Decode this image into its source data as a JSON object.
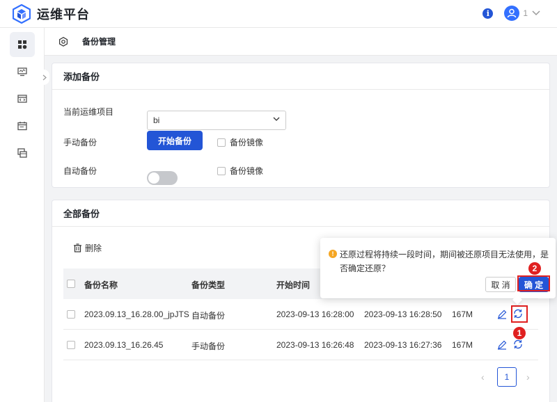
{
  "header": {
    "app_title": "运维平台",
    "info_label": "i",
    "user_name": "1"
  },
  "sidebar": {
    "items": [
      "dashboard-icon",
      "monitor-icon",
      "code-window-icon",
      "calendar-icon",
      "windows-icon"
    ],
    "active_index": 0
  },
  "breadcrumb": {
    "title": "备份管理"
  },
  "add_backup": {
    "title": "添加备份",
    "project_label": "当前运维项目",
    "project_value": "bi",
    "manual_label": "手动备份",
    "start_button": "开始备份",
    "manual_mirror_label": "备份镜像",
    "auto_label": "自动备份",
    "auto_enabled": false,
    "auto_mirror_label": "备份镜像"
  },
  "all_backups": {
    "title": "全部备份",
    "delete_label": "删除",
    "columns": [
      "备份名称",
      "备份类型",
      "开始时间"
    ],
    "rows": [
      {
        "name": "2023.09.13_16.28.00_jpJTS",
        "type": "自动备份",
        "start": "2023-09-13 16:28:00",
        "end": "2023-09-13 16:28:50",
        "size": "167M"
      },
      {
        "name": "2023.09.13_16.26.45",
        "type": "手动备份",
        "start": "2023-09-13 16:26:48",
        "end": "2023-09-13 16:27:36",
        "size": "167M"
      }
    ],
    "pagination": {
      "prev": "‹",
      "current": "1",
      "next": "›"
    }
  },
  "popover": {
    "message": "还原过程将持续一段时间，期间被还原项目无法使用，是否确定还原？",
    "cancel_label": "取 消",
    "confirm_label": "确 定"
  },
  "annotations": {
    "step1": "1",
    "step2": "2",
    "color": "#e02020"
  },
  "colors": {
    "primary": "#2355d6",
    "warning": "#f5a623"
  }
}
